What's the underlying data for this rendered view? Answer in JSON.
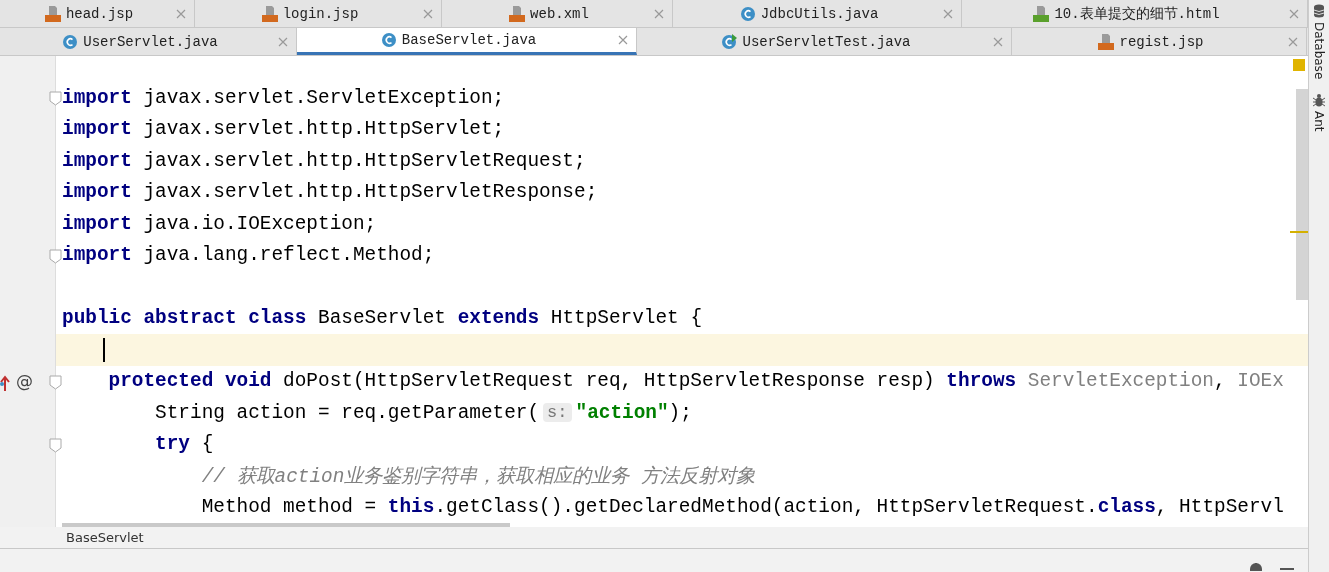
{
  "tab_rows": [
    {
      "tabs": [
        {
          "label": "head.jsp",
          "kind": "jsp",
          "selected": false
        },
        {
          "label": "login.jsp",
          "kind": "jsp",
          "selected": false
        },
        {
          "label": "web.xml",
          "kind": "xml",
          "selected": false
        },
        {
          "label": "JdbcUtils.java",
          "kind": "class",
          "selected": false
        },
        {
          "label": "10.表单提交的细节.html",
          "kind": "html",
          "selected": false
        }
      ]
    },
    {
      "tabs": [
        {
          "label": "UserServlet.java",
          "kind": "class",
          "selected": false
        },
        {
          "label": "BaseServlet.java",
          "kind": "class",
          "selected": true
        },
        {
          "label": "UserServletTest.java",
          "kind": "test",
          "selected": false
        },
        {
          "label": "regist.jsp",
          "kind": "jsp",
          "selected": false
        }
      ]
    }
  ],
  "editor": {
    "lines": [
      {
        "fold": true,
        "current": false,
        "tokens": [
          {
            "kind": "keyword",
            "text": "import"
          },
          {
            "kind": "plain",
            "text": " javax.servlet.ServletException;"
          }
        ]
      },
      {
        "fold": false,
        "current": false,
        "tokens": [
          {
            "kind": "keyword",
            "text": "import"
          },
          {
            "kind": "plain",
            "text": " javax.servlet.http.HttpServlet;"
          }
        ]
      },
      {
        "fold": false,
        "current": false,
        "tokens": [
          {
            "kind": "keyword",
            "text": "import"
          },
          {
            "kind": "plain",
            "text": " javax.servlet.http.HttpServletRequest;"
          }
        ]
      },
      {
        "fold": false,
        "current": false,
        "tokens": [
          {
            "kind": "keyword",
            "text": "import"
          },
          {
            "kind": "plain",
            "text": " javax.servlet.http.HttpServletResponse;"
          }
        ]
      },
      {
        "fold": false,
        "current": false,
        "tokens": [
          {
            "kind": "keyword",
            "text": "import"
          },
          {
            "kind": "plain",
            "text": " java.io.IOException;"
          }
        ]
      },
      {
        "fold": true,
        "current": false,
        "tokens": [
          {
            "kind": "keyword",
            "text": "import"
          },
          {
            "kind": "plain",
            "text": " java.lang.reflect.Method;"
          }
        ]
      },
      {
        "fold": false,
        "current": false
      },
      {
        "fold": false,
        "current": false,
        "tokens": [
          {
            "kind": "keyword",
            "text": "public abstract class"
          },
          {
            "kind": "plain",
            "text": " BaseServlet "
          },
          {
            "kind": "keyword",
            "text": "extends"
          },
          {
            "kind": "plain",
            "text": " HttpServlet {"
          }
        ]
      },
      {
        "fold": false,
        "current": true
      },
      {
        "fold": true,
        "current": false,
        "gutter_mark": "@",
        "tokens": [
          {
            "kind": "keyword",
            "text": "    protected void"
          },
          {
            "kind": "plain",
            "text": " doPost(HttpServletRequest req, HttpServletResponse resp) "
          },
          {
            "kind": "keyword",
            "text": "throws"
          },
          {
            "kind": "dim",
            "text": " ServletException"
          },
          {
            "kind": "plain",
            "text": ", "
          },
          {
            "kind": "dim",
            "text": "IOEx"
          }
        ]
      },
      {
        "fold": false,
        "current": false,
        "tokens": [
          {
            "kind": "plain",
            "text": "        String action = req.getParameter("
          },
          {
            "kind": "hint",
            "text": "s:"
          },
          {
            "kind": "string",
            "text": "\"action\""
          },
          {
            "kind": "plain",
            "text": ");"
          }
        ]
      },
      {
        "fold": true,
        "current": false,
        "tokens": [
          {
            "kind": "keyword",
            "text": "        try"
          },
          {
            "kind": "plain",
            "text": " {"
          }
        ]
      },
      {
        "fold": false,
        "current": false,
        "tokens": [
          {
            "kind": "comment",
            "text": "            // 获取action业务鉴别字符串，获取相应的业务 方法反射对象"
          }
        ]
      },
      {
        "fold": false,
        "current": false,
        "tokens": [
          {
            "kind": "plain",
            "text": "            Method method = "
          },
          {
            "kind": "keyword",
            "text": "this"
          },
          {
            "kind": "plain",
            "text": ".getClass().getDeclaredMethod(action, HttpServletRequest."
          },
          {
            "kind": "keyword",
            "text": "class"
          },
          {
            "kind": "plain",
            "text": ", HttpServl"
          }
        ]
      }
    ]
  },
  "breadcrumb": "BaseServlet",
  "side_tools": [
    {
      "label": "Database",
      "kind": "database"
    },
    {
      "label": "Ant",
      "kind": "ant"
    }
  ]
}
